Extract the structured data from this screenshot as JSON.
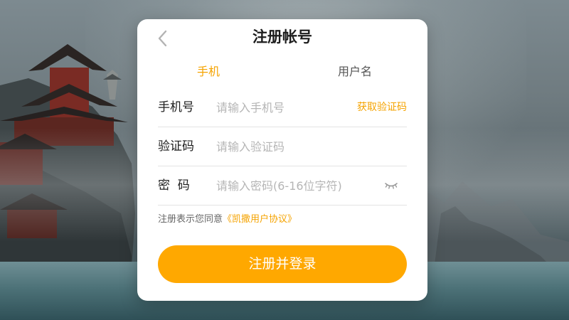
{
  "dialog": {
    "title": "注册帐号"
  },
  "tabs": [
    {
      "label": "手机",
      "active": true
    },
    {
      "label": "用户名",
      "active": false
    }
  ],
  "form": {
    "phone": {
      "label": "手机号",
      "placeholder": "请输入手机号",
      "value": ""
    },
    "get_code_label": "获取验证码",
    "code": {
      "label": "验证码",
      "placeholder": "请输入验证码",
      "value": ""
    },
    "password": {
      "label": "密  码",
      "placeholder": "请输入密码(6-16位字符)",
      "value": ""
    }
  },
  "agreement": {
    "prefix": "注册表示您同意",
    "link_label": "《凯撒用户协议》"
  },
  "submit_label": "注册并登录",
  "colors": {
    "accent": "#ffa800",
    "accent_text": "#f5a300",
    "title": "#1c1c1c",
    "placeholder": "#b5b5b5",
    "divider": "#e4e4e4"
  },
  "icons": {
    "back": "chevron-left-icon",
    "password_toggle": "eye-closed-icon"
  }
}
